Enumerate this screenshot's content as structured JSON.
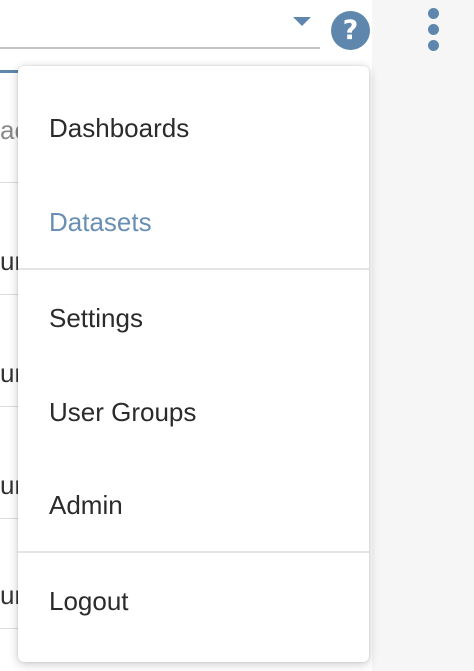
{
  "header": {
    "caret_icon": "chevron-down-icon",
    "help_icon": "question-circle-icon",
    "help_glyph": "?",
    "more_icon": "vertical-ellipsis-icon",
    "accent_color": "#5f87ad"
  },
  "menu": {
    "items": [
      {
        "label": "Dashboards",
        "active": false
      },
      {
        "label": "Datasets",
        "active": true
      },
      {
        "label": "Settings",
        "active": false
      },
      {
        "label": "User Groups",
        "active": false
      },
      {
        "label": "Admin",
        "active": false
      },
      {
        "label": "Logout",
        "active": false
      }
    ],
    "active_color": "#6a8fb5"
  },
  "background": {
    "fragments": [
      "ac",
      "un",
      "un",
      "un",
      "un"
    ]
  }
}
